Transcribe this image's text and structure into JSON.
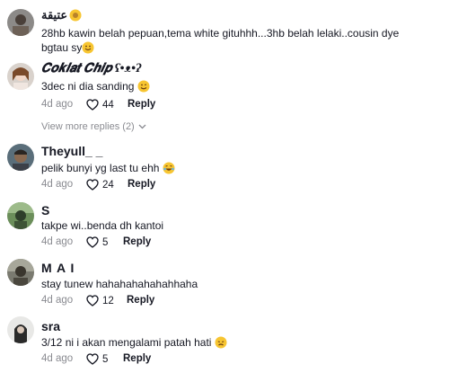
{
  "comments": [
    {
      "username": "عتيقة",
      "text": "28hb kawin belah pepuan,tema white gituhhh...3hb belah lelaki..cousin dye bgtau sy",
      "text_end_emoji": "smile-emoji"
    },
    {
      "username": "𝑪𝒐𝒌𝒍𝒂𝒕 𝑪𝒉𝒊𝒑 ʕ•ᴥ•ʔ",
      "text": "3dec ni dia sanding",
      "date": "4d ago",
      "likes": "44",
      "reply": "Reply",
      "view_more": "View more replies (2)"
    },
    {
      "username": "Theyull_ _",
      "text": "pelik bunyi yg last tu ehh",
      "date": "4d ago",
      "likes": "24",
      "reply": "Reply"
    },
    {
      "username": "S",
      "text": "takpe wi..benda dh kantoi",
      "date": "4d ago",
      "likes": "5",
      "reply": "Reply"
    },
    {
      "username": "M A I",
      "text": "stay tunew hahahahahahahhaha",
      "date": "4d ago",
      "likes": "12",
      "reply": "Reply"
    },
    {
      "username": "sra",
      "text": "3/12 ni i akan mengalami patah hati",
      "date": "4d ago",
      "likes": "5",
      "reply": "Reply"
    }
  ],
  "colors": {
    "text": "#161823",
    "muted": "#8a8b91",
    "emoji": "#f7c531"
  }
}
